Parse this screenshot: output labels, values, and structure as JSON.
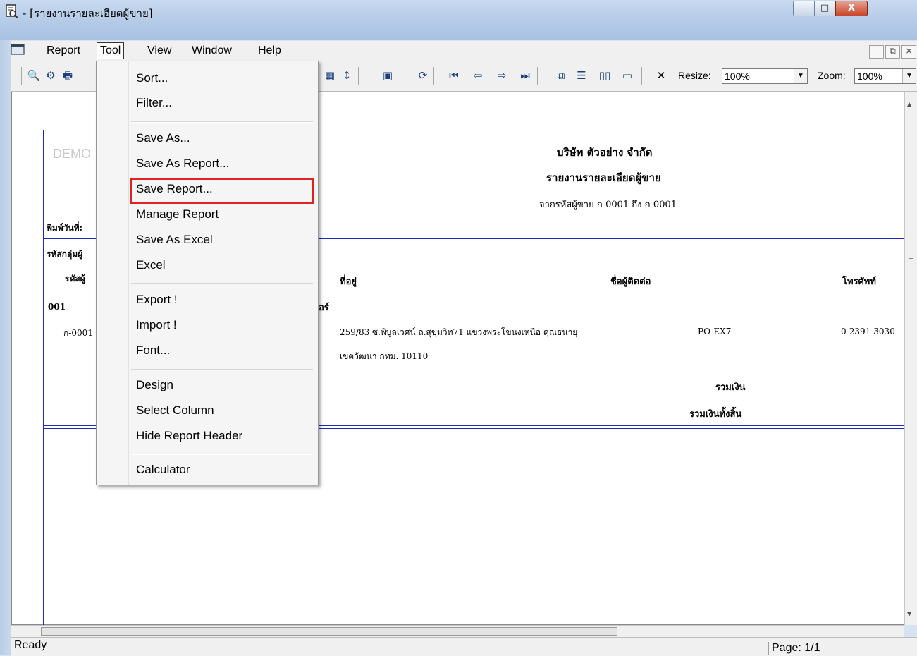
{
  "window": {
    "title": "- [รายงานรายละเอียดผู้ขาย]",
    "min_label": "–",
    "max_label": "□",
    "close_label": "X"
  },
  "menubar": {
    "items": [
      "Report",
      "Tool",
      "View",
      "Window",
      "Help"
    ],
    "mdi_min": "–",
    "mdi_restore": "⧉",
    "mdi_close": "×"
  },
  "toolbar": {
    "resize_label": "Resize:",
    "resize_value": "100%",
    "zoom_label": "Zoom:",
    "zoom_value": "100%",
    "close_glyph": "✕"
  },
  "tool_menu": {
    "items": [
      "Sort...",
      "Filter...",
      "Save As...",
      "Save As Report...",
      "Save Report...",
      "Manage Report",
      "Save As Excel",
      "Excel",
      "Export !",
      "Import !",
      "Font...",
      "Design",
      "Select Column",
      "Hide Report Header",
      "Calculator"
    ],
    "highlighted": "Save Report..."
  },
  "report": {
    "watermark": "DEMO",
    "company": "บริษัท ตัวอย่าง จำกัด",
    "report_title": "รายงานรายละเอียดผู้ขาย",
    "range": "จากรหัสผู้ขาย ก-0001 ถึง ก-0001",
    "print_date_label": "พิมพ์วันที่:",
    "group_label": "รหัสกลุ่มผู้",
    "col_code": "รหัสผู้",
    "col_address": "ที่อยู่",
    "col_contact": "ชื่อผู้ติดต่อ",
    "col_phone": "โทรศัพท์",
    "group_code": "001",
    "group_suffix": "อร์",
    "vendor_code": "ก-0001",
    "address_line1": "259/83 ซ.พิบูลเวศน์ ถ.สุขุมวิท71  แขวงพระโขนงเหนือ คุณธนายุ",
    "address_line2": "เขตวัฒนา กทม. 10110",
    "contact_code": "PO-EX7",
    "phone": "0-2391-3030",
    "subtotal_label": "รวมเงิน",
    "grandtotal_label": "รวมเงินทั้งสิ้น"
  },
  "status": {
    "text": "Ready",
    "page": "Page: 1/1"
  }
}
